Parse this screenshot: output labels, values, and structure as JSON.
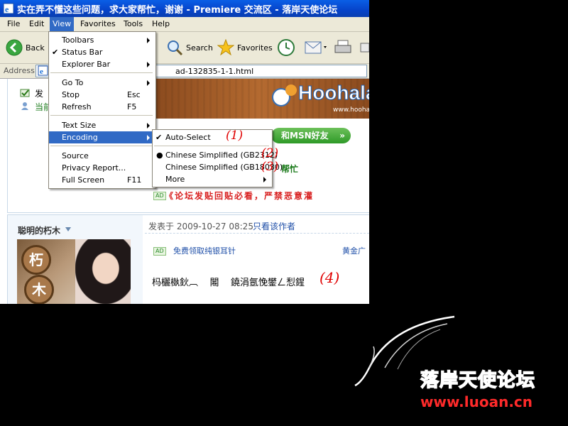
{
  "window": {
    "title": "实在弄不懂这些问题，求大家帮忙，谢谢 - Premiere 交流区 - 落岸天使论坛"
  },
  "menubar": [
    "File",
    "Edit",
    "View",
    "Favorites",
    "Tools",
    "Help"
  ],
  "toolbar": {
    "back": "Back",
    "search": "Search",
    "favorites": "Favorites"
  },
  "address": {
    "label": "Address",
    "url": "ad-132835-1-1.html"
  },
  "view_menu": {
    "toolbars": "Toolbars",
    "status_bar": "Status Bar",
    "explorer_bar": "Explorer Bar",
    "go_to": "Go To",
    "stop": "Stop",
    "stop_key": "Esc",
    "refresh": "Refresh",
    "refresh_key": "F5",
    "text_size": "Text Size",
    "encoding": "Encoding",
    "source": "Source",
    "privacy_report": "Privacy Report...",
    "full_screen": "Full Screen",
    "full_screen_key": "F11"
  },
  "encoding_menu": {
    "auto_select": "Auto-Select",
    "gb2312": "Chinese Simplified (GB2312)",
    "gb18030": "Chinese Simplified (GB18030)",
    "more": "More"
  },
  "annotations": {
    "a1": "(1)",
    "a2": "(2)",
    "a3": "(3)",
    "a4": "(4)"
  },
  "page": {
    "post_fragment": "发",
    "current_fragment": "当前",
    "banner_logo": "Hoohala",
    "banner_url": "www.hoohala",
    "msn_btn": "和MSN好友",
    "help_fragment": "帮忙",
    "ad_badge": "AD",
    "notice": "《论坛发贴回贴必看，严禁恶意灌",
    "user_name": "聪明的朽木",
    "avatar_text_1": "朽",
    "avatar_text_2": "木",
    "posted_label": "发表于 2009-10-27 08:25",
    "only_author": "只看该作者",
    "ad_text": "免费领取纯银耳针",
    "ad_right": "黄金广",
    "garbled": "杩欐槸鈥︹    闂    鐃涓氬悗鐢ㄥ悡鍟"
  },
  "watermark": {
    "cn": "落岸天使论坛",
    "url": "www.luoan.cn"
  }
}
